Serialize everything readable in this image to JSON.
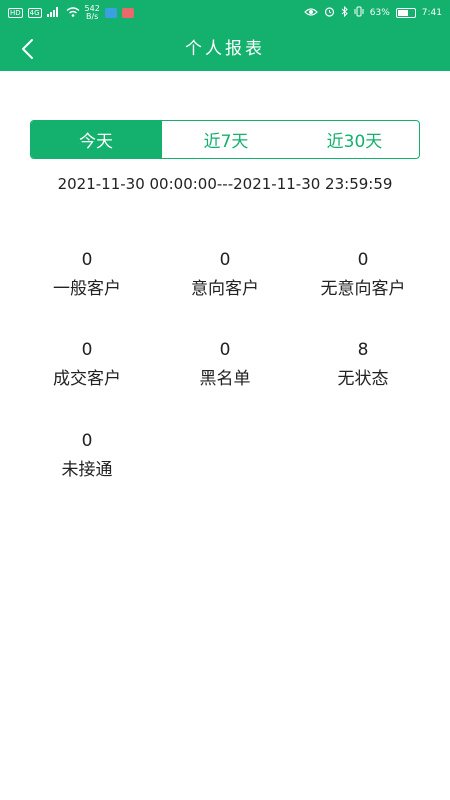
{
  "status_bar": {
    "left_badges": [
      "HD",
      "4G"
    ],
    "net_speed_value": "542",
    "net_speed_unit": "B/s",
    "battery_text": "63%",
    "battery_level": 0.63,
    "time": "7:41"
  },
  "header": {
    "title": "个人报表"
  },
  "tabs": [
    {
      "label": "今天",
      "selected": true
    },
    {
      "label": "近7天",
      "selected": false
    },
    {
      "label": "近30天",
      "selected": false
    }
  ],
  "date_range": "2021-11-30 00:00:00---2021-11-30 23:59:59",
  "stats": [
    {
      "value": "0",
      "label": "一般客户"
    },
    {
      "value": "0",
      "label": "意向客户"
    },
    {
      "value": "0",
      "label": "无意向客户"
    },
    {
      "value": "0",
      "label": "成交客户"
    },
    {
      "value": "0",
      "label": "黑名单"
    },
    {
      "value": "8",
      "label": "无状态"
    },
    {
      "value": "0",
      "label": "未接通"
    }
  ],
  "colors": {
    "primary": "#13b06e",
    "text": "#222222",
    "background": "#ffffff"
  }
}
